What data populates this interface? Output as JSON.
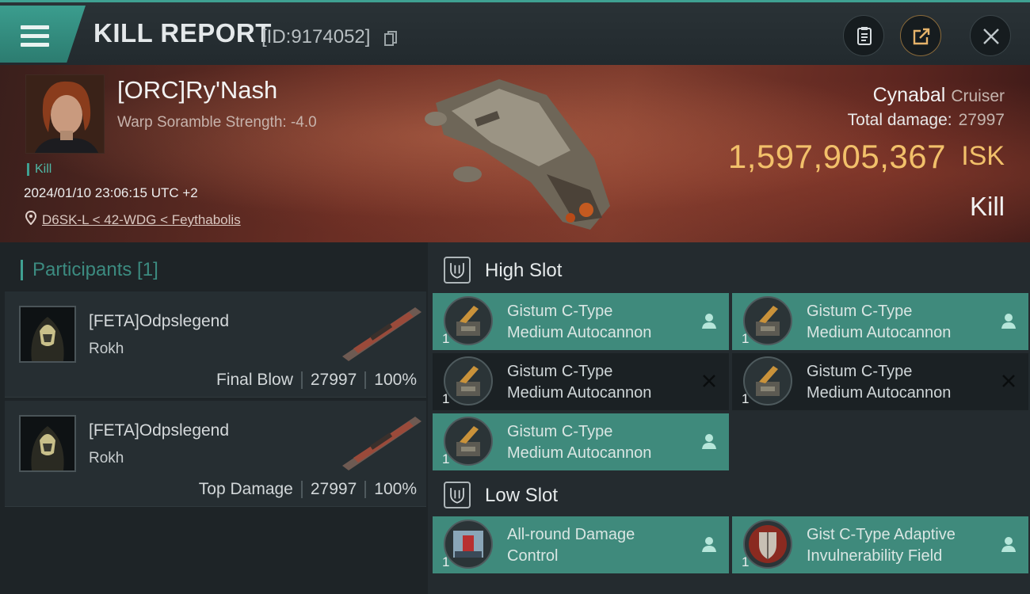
{
  "header": {
    "title": "KILL REPORT",
    "report_id": "[ID:9174052]"
  },
  "victim": {
    "name": "[ORC]Ry'Nash",
    "warp_scramble": "Warp Soramble Strength: -4.0",
    "kill_tag": "Kill",
    "datetime": "2024/01/10 23:06:15 UTC +2",
    "location": "D6SK-L < 42-WDG < Feythabolis",
    "ship_name": "Cynabal",
    "ship_class": "Cruiser",
    "total_damage_label": "Total damage:",
    "total_damage": "27997",
    "isk_value": "1,597,905,367",
    "isk_unit": "ISK",
    "result": "Kill"
  },
  "participants": {
    "title": "Participants [1]",
    "list": [
      {
        "name": "[FETA]Odpslegend",
        "ship": "Rokh",
        "role": "Final Blow",
        "damage": "27997",
        "percent": "100%"
      },
      {
        "name": "[FETA]Odpslegend",
        "ship": "Rokh",
        "role": "Top Damage",
        "damage": "27997",
        "percent": "100%"
      }
    ]
  },
  "slots": {
    "high": {
      "title": "High Slot",
      "modules": [
        {
          "line1": "Gistum C-Type",
          "line2": "Medium Autocannon",
          "qty": "1",
          "status": "fitted"
        },
        {
          "line1": "Gistum C-Type",
          "line2": "Medium Autocannon",
          "qty": "1",
          "status": "fitted"
        },
        {
          "line1": "Gistum C-Type",
          "line2": "Medium Autocannon",
          "qty": "1",
          "status": "destroyed"
        },
        {
          "line1": "Gistum C-Type",
          "line2": "Medium Autocannon",
          "qty": "1",
          "status": "destroyed"
        },
        {
          "line1": "Gistum C-Type",
          "line2": "Medium Autocannon",
          "qty": "1",
          "status": "fitted"
        }
      ]
    },
    "low": {
      "title": "Low Slot",
      "modules": [
        {
          "line1": "All-round Damage",
          "line2": "Control",
          "qty": "1",
          "status": "fitted"
        },
        {
          "line1": "Gist C-Type Adaptive",
          "line2": "Invulnerability Field",
          "qty": "1",
          "status": "fitted"
        }
      ]
    }
  },
  "colors": {
    "accent": "#3fa192",
    "fitted_row": "#3f8a7c",
    "isk": "#f2c06a"
  },
  "icons": [
    "menu-icon",
    "copy-icon",
    "clipboard-icon",
    "share-icon",
    "close-icon",
    "location-pin-icon",
    "slot-shield-icon",
    "pilot-icon",
    "destroyed-x-icon"
  ]
}
